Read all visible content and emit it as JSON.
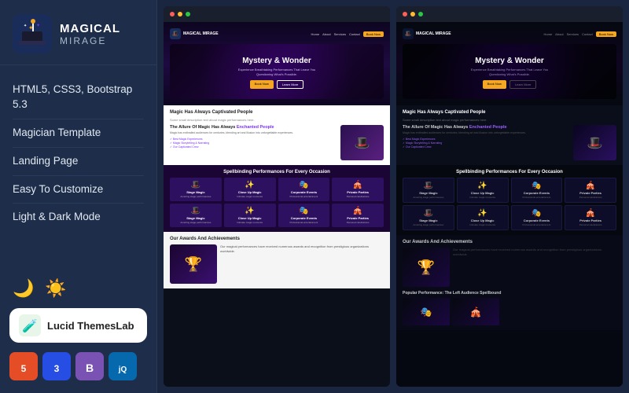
{
  "sidebar": {
    "logo": {
      "name": "MAGICAL",
      "sub": "MIRAGE"
    },
    "features": [
      {
        "text": "HTML5, CSS3, Bootstrap 5.3"
      },
      {
        "text": "Magician Template"
      },
      {
        "text": "Landing Page"
      },
      {
        "text": "Easy To Customize"
      },
      {
        "text": "Light & Dark Mode"
      }
    ],
    "brand": {
      "name": "Lucid ThemesLab"
    },
    "tech": [
      {
        "label": "H5",
        "type": "html"
      },
      {
        "label": "C3",
        "type": "css"
      },
      {
        "label": "B",
        "type": "bs"
      },
      {
        "label": "jQ",
        "type": "jq"
      }
    ]
  },
  "preview": {
    "hero_title": "Mystery & Wonder",
    "hero_subtitle": "Experience Breathtaking Performances That Leave You Questioning What's Possible.",
    "section1_title": "Magic Has Always Captivated People",
    "section2_title": "The Allure Of Magic Has Always Enchanted People",
    "services_title": "Spellbinding Performances For Every Occasion",
    "awards_title": "Our Awards And Achievements",
    "popular_title": "Popular Performance: The Left Audience Spellbound",
    "cards": [
      {
        "icon": "🎩",
        "title": "Stage Magic",
        "desc": "Amazing stage performances"
      },
      {
        "icon": "✨",
        "title": "Close Up Magic",
        "desc": "Intimate magic moments"
      },
      {
        "icon": "🎭",
        "title": "Corporate Events",
        "desc": "Professional entertainment"
      },
      {
        "icon": "🎪",
        "title": "Private Parties",
        "desc": "Personal celebrations"
      }
    ],
    "bullets": [
      "Best Magic Experiences",
      "Magic Storytelling & Narrating",
      "Our Captivated Crew"
    ]
  }
}
